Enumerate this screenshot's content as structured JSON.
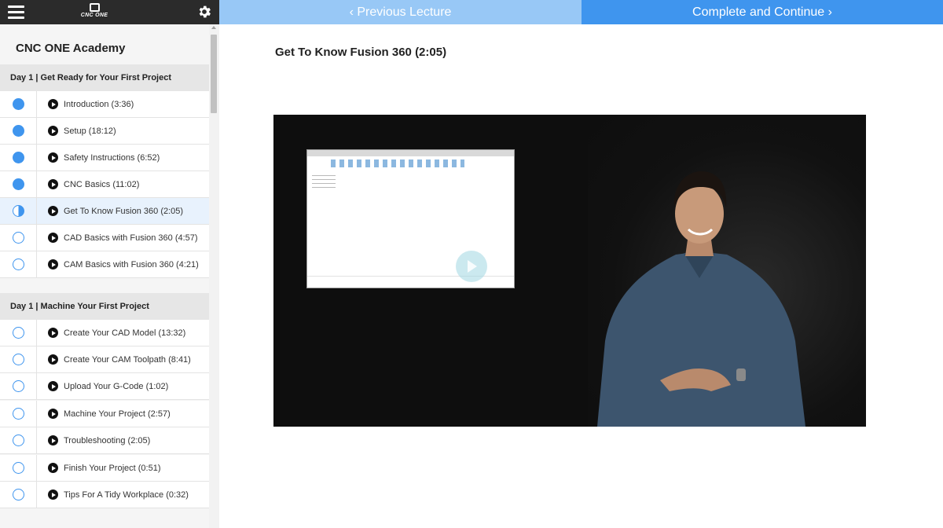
{
  "header": {
    "logo_text": "CNC ONE",
    "prev_label": "Previous Lecture",
    "next_label": "Complete and Continue",
    "icons": {
      "menu": "hamburger-menu-icon",
      "settings": "gear-icon",
      "prev": "chevron-left-icon",
      "next": "chevron-right-icon"
    },
    "colors": {
      "topbar": "#2b2b2b",
      "prev_bg": "#98c8f6",
      "next_bg": "#3f95ee"
    }
  },
  "sidebar": {
    "course_title": "CNC ONE Academy",
    "sections": [
      {
        "title": "Day 1 | Get Ready for Your First Project",
        "lectures": [
          {
            "label": "Introduction (3:36)",
            "status": "complete"
          },
          {
            "label": "Setup (18:12)",
            "status": "complete"
          },
          {
            "label": "Safety Instructions (6:52)",
            "status": "complete"
          },
          {
            "label": "CNC Basics (11:02)",
            "status": "complete"
          },
          {
            "label": "Get To Know Fusion 360 (2:05)",
            "status": "in-progress"
          },
          {
            "label": "CAD Basics with Fusion 360 (4:57)",
            "status": "incomplete"
          },
          {
            "label": "CAM Basics with Fusion 360 (4:21)",
            "status": "incomplete"
          }
        ]
      },
      {
        "title": "Day 1 | Machine Your First Project",
        "lectures": [
          {
            "label": "Create Your CAD Model (13:32)",
            "status": "incomplete"
          },
          {
            "label": "Create Your CAM Toolpath (8:41)",
            "status": "incomplete"
          },
          {
            "label": "Upload Your G-Code (1:02)",
            "status": "incomplete"
          },
          {
            "label": "Machine Your Project (2:57)",
            "status": "incomplete"
          },
          {
            "label": "Troubleshooting (2:05)",
            "status": "incomplete"
          },
          {
            "label": "Finish Your Project (0:51)",
            "status": "incomplete"
          },
          {
            "label": "Tips For A Tidy Workplace (0:32)",
            "status": "incomplete"
          }
        ]
      }
    ],
    "colors": {
      "accent": "#3f95ee",
      "active_row": "#e8f2fd",
      "section_bg": "#e6e6e6"
    }
  },
  "main": {
    "lecture_title": "Get To Know Fusion 360 (2:05)",
    "video": {
      "state": "paused",
      "icon": "play-icon"
    }
  }
}
